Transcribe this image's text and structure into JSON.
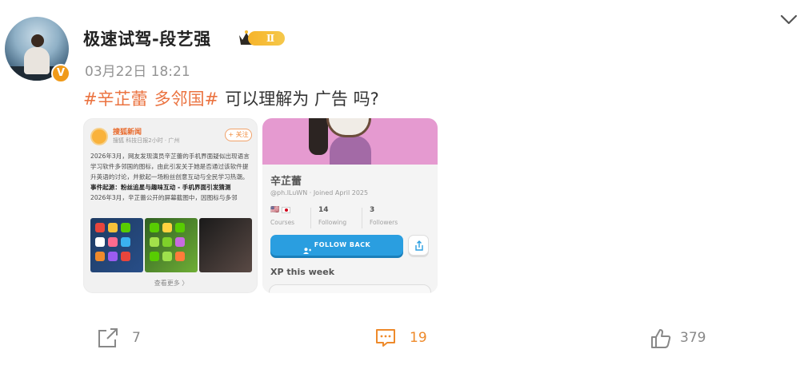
{
  "post": {
    "username": "极速试驾-段艺强",
    "vip_level": "Ⅱ",
    "verified_mark": "V",
    "timestamp": "03月22日 18:21",
    "tag1": "#辛芷蕾",
    "tag2": "多邻国#",
    "text": "可以理解为 广告 吗?"
  },
  "card1": {
    "account_name": "搜狐新闻",
    "meta": "搜狐 科技日报2小时 · 广州",
    "follow_label": "+ 关注",
    "body": "2026年3月，网友发现演员辛芷蕾的手机界面疑似出现语言学习软件多邻国的图标，由此引发关于她是否通过该软件提升英语的讨论，并掀起一场粉丝创意互动与全民学习热潮。",
    "section_title": "事件起源：粉丝追星与趣味互动 - 手机界面引发猜测",
    "section_body": "2026年3月，辛芷蕾公开的屏幕截图中，因图标与多邻",
    "more_label": "查看更多 〉"
  },
  "card2": {
    "name": "辛芷蕾",
    "handle": "@ph.lLuWN · Joined April 2025",
    "stats": [
      {
        "num": "14",
        "label": "Following"
      },
      {
        "num": "3",
        "label": "Followers"
      }
    ],
    "courses_label": "Courses",
    "follow_back_label": "FOLLOW BACK",
    "xp_label": "XP this week"
  },
  "actions": {
    "share_count": "7",
    "comment_count": "19",
    "like_count": "379"
  },
  "colors": {
    "tag": "#eb7340",
    "accent": "#f09a19",
    "follow_blue": "#2a9ee0"
  }
}
